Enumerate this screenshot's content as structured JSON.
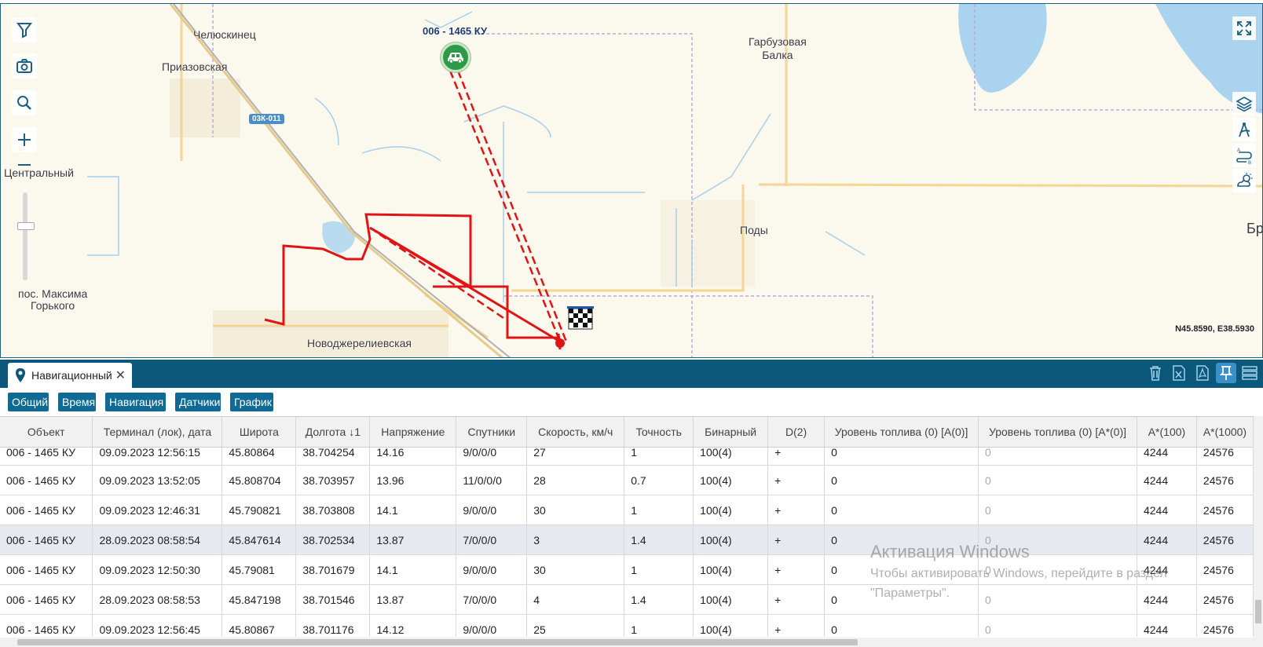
{
  "map": {
    "places": {
      "chelyuskinets": "Челюскинец",
      "priazovskaya": "Приазовская",
      "tsentralny": "Центральный",
      "maxim_gorky": "пос. Максима\nГорького",
      "novodzherelievskaya": "Новоджерелиевская",
      "garbuzovaya_balka": "Гарбузовая\nБалка",
      "pody": "Поды",
      "edge": "Бр"
    },
    "road_badge": "03К-011",
    "vehicle_label": "006 - 1465 КУ",
    "coords": "N45.8590, E38.5930",
    "colors": {
      "track": "#e01414",
      "vehicle": "#2e9a48",
      "water": "#a9d3ef"
    }
  },
  "panel": {
    "tab_label": "Навигационный",
    "tab_icon": "location-pin-icon",
    "tools": [
      "trash-icon",
      "excel-export-icon",
      "pdf-export-icon",
      "pin-icon",
      "layout-icon"
    ],
    "subtabs": [
      "Общий",
      "Время",
      "Навигация",
      "Датчики",
      "График"
    ]
  },
  "table": {
    "columns": [
      "Объект",
      "Терминал (лок), дата",
      "Широта",
      "Долгота ↓1",
      "Напряжение",
      "Спутники",
      "Скорость, км/ч",
      "Точность",
      "Бинарный",
      "D(2)",
      "Уровень топлива (0) [A(0)]",
      "Уровень топлива (0) [A*(0)]",
      "A*(100)",
      "A*(1000)"
    ],
    "partial_row": [
      "006 - 1465 КУ",
      "09.09.2023 12:56:15",
      "45.80864",
      "38.704254",
      "14.16",
      "9/0/0/0",
      "27",
      "1",
      "100(4)",
      "+",
      "0",
      "0",
      "4244",
      "24576"
    ],
    "rows": [
      [
        "006 - 1465 КУ",
        "09.09.2023 13:52:05",
        "45.808704",
        "38.703957",
        "13.96",
        "11/0/0/0",
        "28",
        "0.7",
        "100(4)",
        "+",
        "0",
        "0",
        "4244",
        "24576"
      ],
      [
        "006 - 1465 КУ",
        "09.09.2023 12:46:31",
        "45.790821",
        "38.703808",
        "14.1",
        "9/0/0/0",
        "30",
        "1",
        "100(4)",
        "+",
        "0",
        "0",
        "4244",
        "24576"
      ],
      [
        "006 - 1465 КУ",
        "28.09.2023 08:58:54",
        "45.847614",
        "38.702534",
        "13.87",
        "7/0/0/0",
        "3",
        "1.4",
        "100(4)",
        "+",
        "0",
        "0",
        "4244",
        "24576"
      ],
      [
        "006 - 1465 КУ",
        "09.09.2023 12:50:30",
        "45.79081",
        "38.701679",
        "14.1",
        "9/0/0/0",
        "30",
        "1",
        "100(4)",
        "+",
        "0",
        "0",
        "4244",
        "24576"
      ],
      [
        "006 - 1465 КУ",
        "28.09.2023 08:58:53",
        "45.847198",
        "38.701546",
        "13.87",
        "7/0/0/0",
        "4",
        "1.4",
        "100(4)",
        "+",
        "0",
        "0",
        "4244",
        "24576"
      ],
      [
        "006 - 1465 КУ",
        "09.09.2023 12:56:45",
        "45.80867",
        "38.701176",
        "14.12",
        "9/0/0/0",
        "25",
        "1",
        "100(4)",
        "+",
        "0",
        "0",
        "4244",
        "24576"
      ]
    ],
    "selected_row": 2
  },
  "watermark": {
    "title": "Активация Windows",
    "line1": "Чтобы активировать Windows, перейдите в раздел",
    "line2": "\"Параметры\"."
  }
}
